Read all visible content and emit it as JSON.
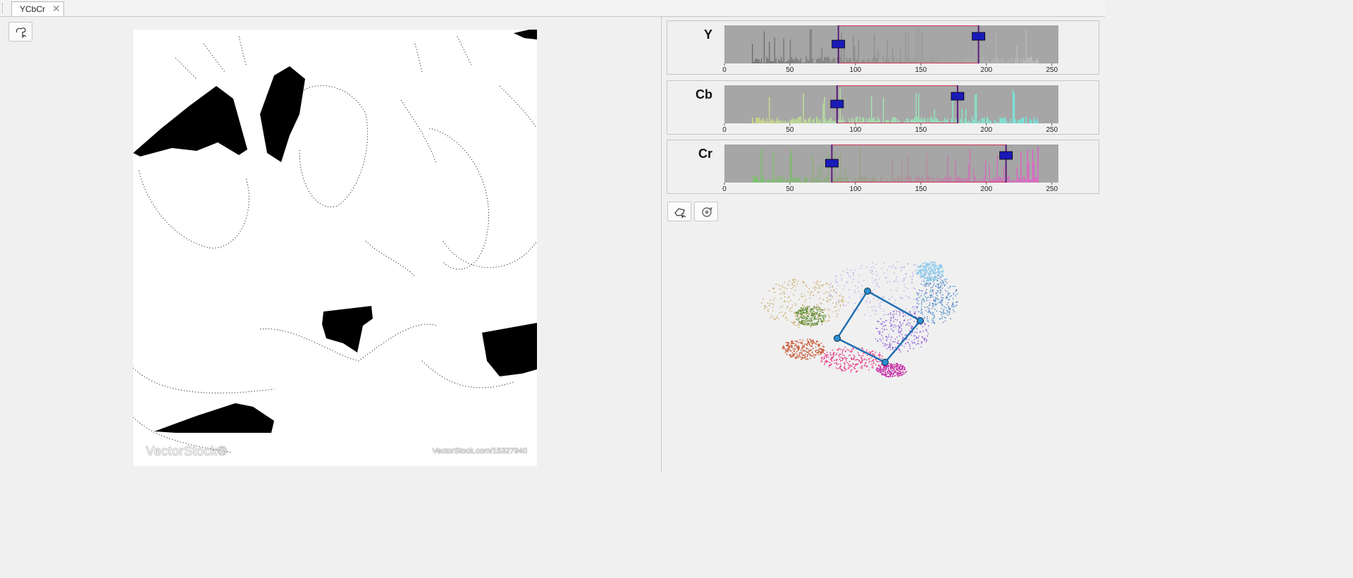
{
  "tab": {
    "title": "YCbCr"
  },
  "image": {
    "watermark_left": "VectorStock®",
    "watermark_right": "VectorStock.com/15327940"
  },
  "axis_ticks": [
    "0",
    "50",
    "100",
    "150",
    "200",
    "250"
  ],
  "histograms": [
    {
      "channel": "Y",
      "range_low": 87,
      "range_high": 194,
      "colors": [
        "#555555",
        "#cccccc"
      ]
    },
    {
      "channel": "Cb",
      "range_low": 86,
      "range_high": 178,
      "colors": [
        "#e8e870",
        "#55ffff"
      ]
    },
    {
      "channel": "Cr",
      "range_low": 82,
      "range_high": 215,
      "colors": [
        "#55dd44",
        "#ff44dd"
      ]
    }
  ],
  "toolbar": {
    "left_select_icon": "polygon-select-icon",
    "polygon_icon": "polygon-draw-icon",
    "rotate_icon": "rotate-view-icon"
  },
  "accent": "#1f6fb2",
  "handle_color": "#1a1ab8"
}
